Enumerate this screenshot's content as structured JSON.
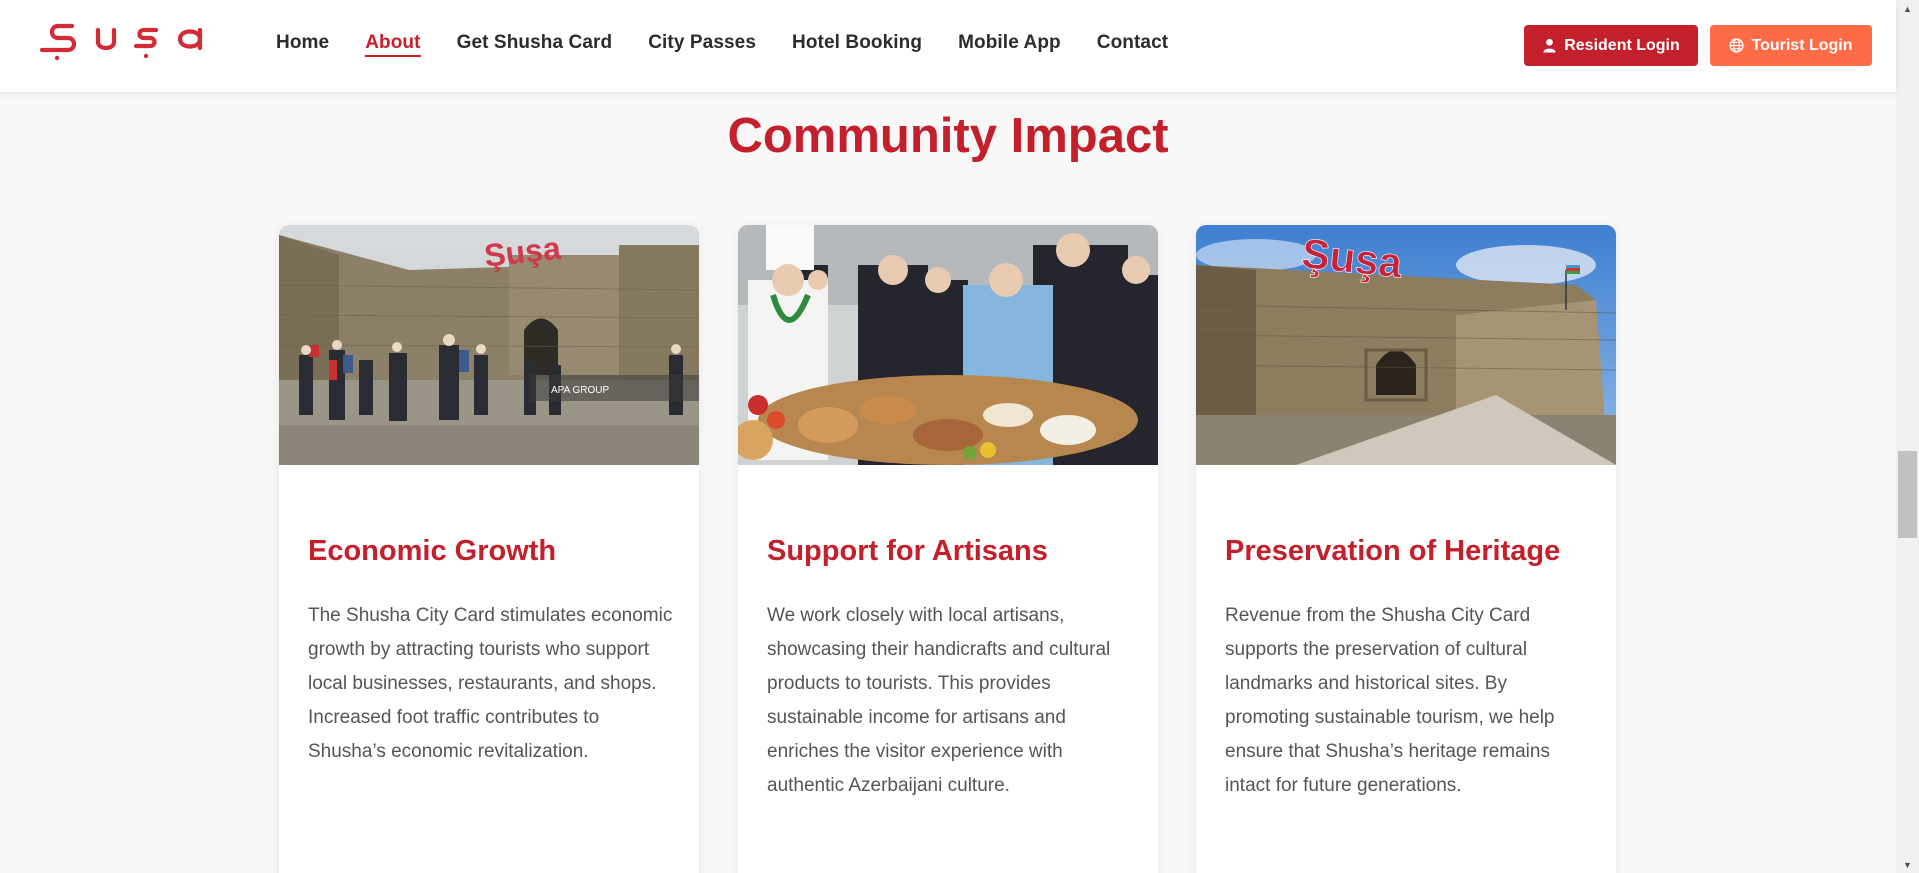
{
  "header": {
    "logo_text": "Şuşa",
    "nav": [
      {
        "label": "Home",
        "active": false
      },
      {
        "label": "About",
        "active": true
      },
      {
        "label": "Get Shusha Card",
        "active": false
      },
      {
        "label": "City Passes",
        "active": false
      },
      {
        "label": "Hotel Booking",
        "active": false
      },
      {
        "label": "Mobile App",
        "active": false
      },
      {
        "label": "Contact",
        "active": false
      }
    ],
    "resident_login": "Resident Login",
    "tourist_login": "Tourist Login"
  },
  "section": {
    "title": "Community Impact",
    "cards": [
      {
        "title": "Economic Growth",
        "text": "The Shusha City Card stimulates economic growth by attracting tourists who support local businesses, restaurants, and shops. Increased foot traffic contributes to Shusha’s economic revitalization.",
        "image_watermark": "APA GROUP",
        "image_sign": "Şuşa"
      },
      {
        "title": "Support for Artisans",
        "text": "We work closely with local artisans, showcasing their handicrafts and cultural products to tourists. This provides sustainable income for artisans and enriches the visitor experience with authentic Azerbaijani culture."
      },
      {
        "title": "Preservation of Heritage",
        "text": "Revenue from the Shusha City Card supports the preservation of cultural landmarks and historical sites. By promoting sustainable tourism, we help ensure that Shusha’s heritage remains intact for future generations.",
        "image_sign": "Şuşa"
      }
    ]
  },
  "colors": {
    "brand_red": "#c3202c",
    "tourist_orange": "#ff6b47",
    "background": "#f8f8f8"
  },
  "icons": {
    "resident": "user-icon",
    "tourist": "globe-icon"
  }
}
